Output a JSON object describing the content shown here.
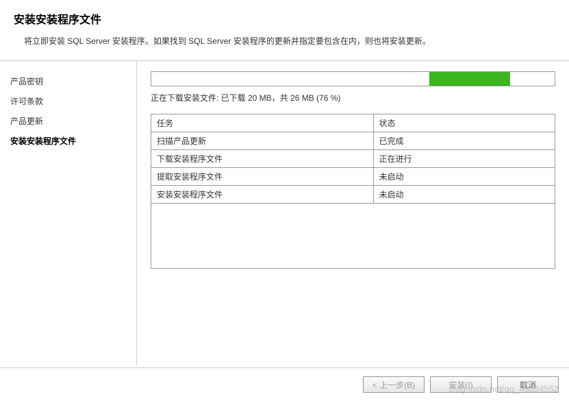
{
  "header": {
    "title": "安装安装程序文件",
    "description": "将立即安装 SQL Server 安装程序。如果找到 SQL Server 安装程序的更新并指定要包含在内，则也将安装更新。"
  },
  "sidebar": {
    "items": [
      {
        "label": "产品密钥",
        "active": false
      },
      {
        "label": "许可条款",
        "active": false
      },
      {
        "label": "产品更新",
        "active": false
      },
      {
        "label": "安装安装程序文件",
        "active": true
      }
    ]
  },
  "main": {
    "status_text": "正在下载安装文件: 已下载 20 MB，共 26 MB (76 %)",
    "progress_percent": 76,
    "table": {
      "headers": {
        "task": "任务",
        "status": "状态"
      },
      "rows": [
        {
          "task": "扫描产品更新",
          "status": "已完成"
        },
        {
          "task": "下载安装程序文件",
          "status": "正在进行"
        },
        {
          "task": "提取安装程序文件",
          "status": "未启动"
        },
        {
          "task": "安装安装程序文件",
          "status": "未启动"
        }
      ]
    }
  },
  "footer": {
    "back_label": "< 上一步(B)",
    "install_label": "安装(I)",
    "cancel_label": "取消"
  },
  "watermark": "blog.csdn.net/qq_43624552"
}
